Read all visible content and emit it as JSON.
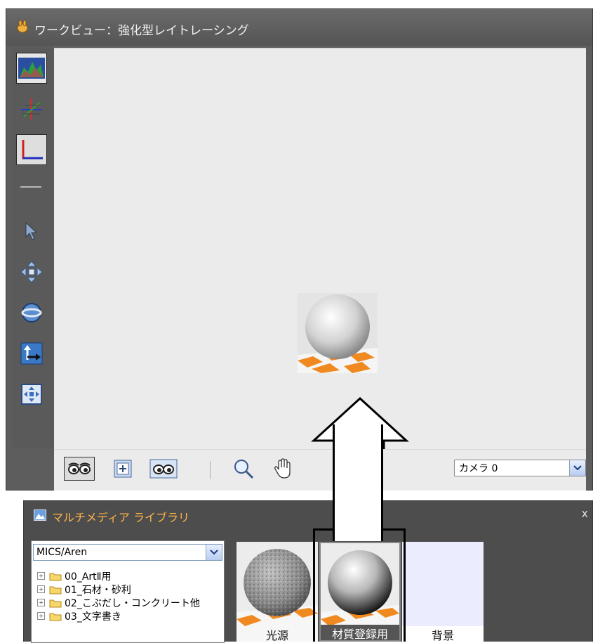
{
  "work_view": {
    "title": "ワークビュー：強化型レイトレーシング",
    "camera_select": {
      "value": "カメラ 0"
    }
  },
  "library": {
    "title": "マルチメディア ライブラリ",
    "close_label": "x",
    "path_select": {
      "value": "MICS/Aren"
    },
    "folders": [
      {
        "label": "00_ArtⅡ用"
      },
      {
        "label": "01_石材・砂利"
      },
      {
        "label": "02_こぶだし・コンクリート他"
      },
      {
        "label": "03_文字書き"
      }
    ],
    "thumbnails": [
      {
        "label": "光源"
      },
      {
        "label": "材質登録用"
      },
      {
        "label": "背景"
      }
    ]
  },
  "colors": {
    "accent": "#ff8a00",
    "title_text": "#ffb24a",
    "panel_bg": "#5d5d5d",
    "canvas_bg": "#ebebeb"
  }
}
